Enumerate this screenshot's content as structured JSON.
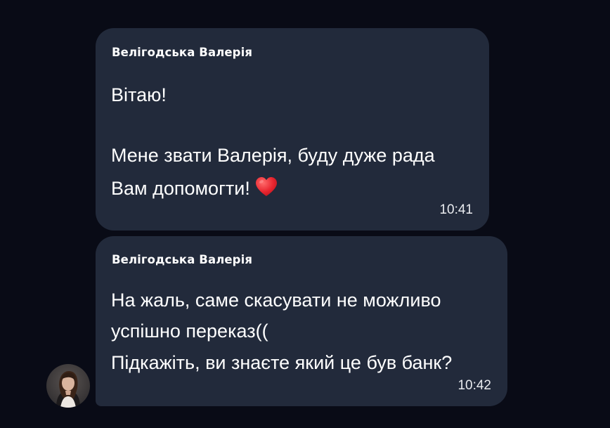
{
  "messages": [
    {
      "sender": "Велігодська Валерія",
      "lines": [
        "Вітаю!",
        "",
        "Мене звати Валерія, буду дуже рада",
        "Вам допомогти!"
      ],
      "emoji": "heart-emoji",
      "time": "10:41"
    },
    {
      "sender": "Велігодська Валерія",
      "lines": [
        "На жаль, саме скасувати не можливо",
        "успішно переказ((",
        "Підкажіть, ви знаєте який це був банк?"
      ],
      "time": "10:42"
    }
  ],
  "colors": {
    "background": "#090b16",
    "bubble": "#222a3b",
    "text": "#ffffff",
    "heart": "#e8252f"
  }
}
